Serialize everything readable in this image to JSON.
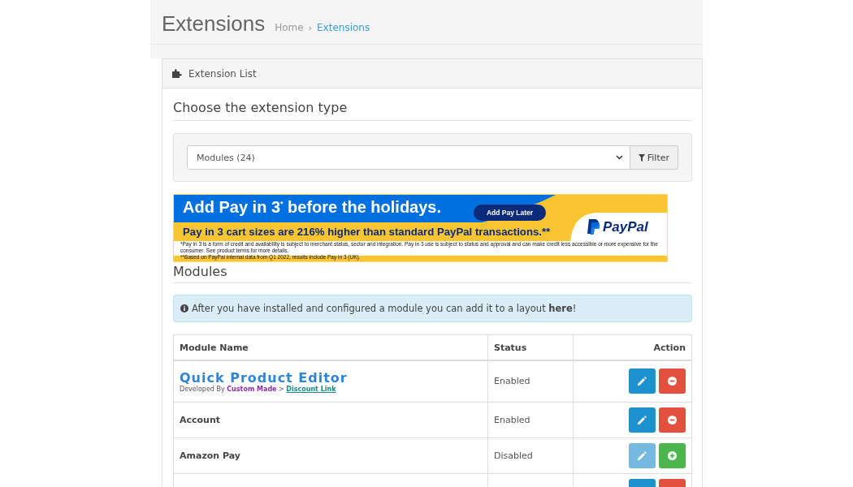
{
  "page_header": {
    "title": "Extensions",
    "breadcrumb_separator": "›",
    "breadcrumbs": [
      {
        "label": "Home",
        "selected": false
      },
      {
        "label": "Extensions",
        "selected": true
      }
    ]
  },
  "panel": {
    "title": "Extension List",
    "type_heading": "Choose the extension type",
    "type_select": {
      "value": "Modules (24)"
    },
    "filter_button": "Filter",
    "banner": {
      "headline": "Add Pay in 3",
      "headline_mark": "*",
      "headline_rest": "before the holidays.",
      "button": "Add Pay Later",
      "subline": "Pay in 3 cart sizes are 216% higher than standard PayPal transactions.**",
      "logo": "PayPal",
      "footnotes": [
        "*Pay in 3 is a form of credit and availability is subject to merchant status, sector and integration. Pay in 3 use is subject to status and approval and can make credit less accessible or more expensive for the consumer. See product terms for more details.",
        "**Based on PayPal internal data from Q1 2022, results include Pay in 3 (UK)."
      ]
    },
    "section_heading": "Modules",
    "alert": {
      "text": "After you have installed and configured a module you can add it to a layout **here**!"
    },
    "table": {
      "columns": [
        "Module Name",
        "Status",
        "Action"
      ],
      "rows": [
        {
          "kind": "featured",
          "name": "Quick Product Editor",
          "developer_prefix": "Developed By",
          "developer": "Custom Made",
          "separator": ">",
          "link": "Discount Link",
          "status": "Enabled",
          "installed": true
        },
        {
          "kind": "plain",
          "name": "Account",
          "status": "Enabled",
          "installed": true
        },
        {
          "kind": "plain",
          "name": "Amazon Pay",
          "status": "Disabled",
          "installed": false
        },
        {
          "kind": "cut",
          "installed": true
        }
      ]
    }
  }
}
